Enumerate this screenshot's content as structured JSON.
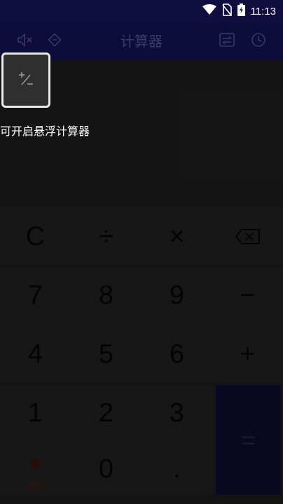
{
  "status_bar": {
    "time": "11:13"
  },
  "app_bar": {
    "title": "计算器"
  },
  "float_hint": "可开启悬浮计算器",
  "keys": {
    "clear": "C",
    "divide": "÷",
    "multiply": "×",
    "seven": "7",
    "eight": "8",
    "nine": "9",
    "minus": "−",
    "four": "4",
    "five": "5",
    "six": "6",
    "plus": "+",
    "one": "1",
    "two": "2",
    "three": "3",
    "zero": "0",
    "dot": ".",
    "equals": "=",
    "skin_label": "皮肤"
  },
  "colors": {
    "app_bar": "#0e0c38",
    "equals_key": "#14124a",
    "keypad": "#333333"
  }
}
